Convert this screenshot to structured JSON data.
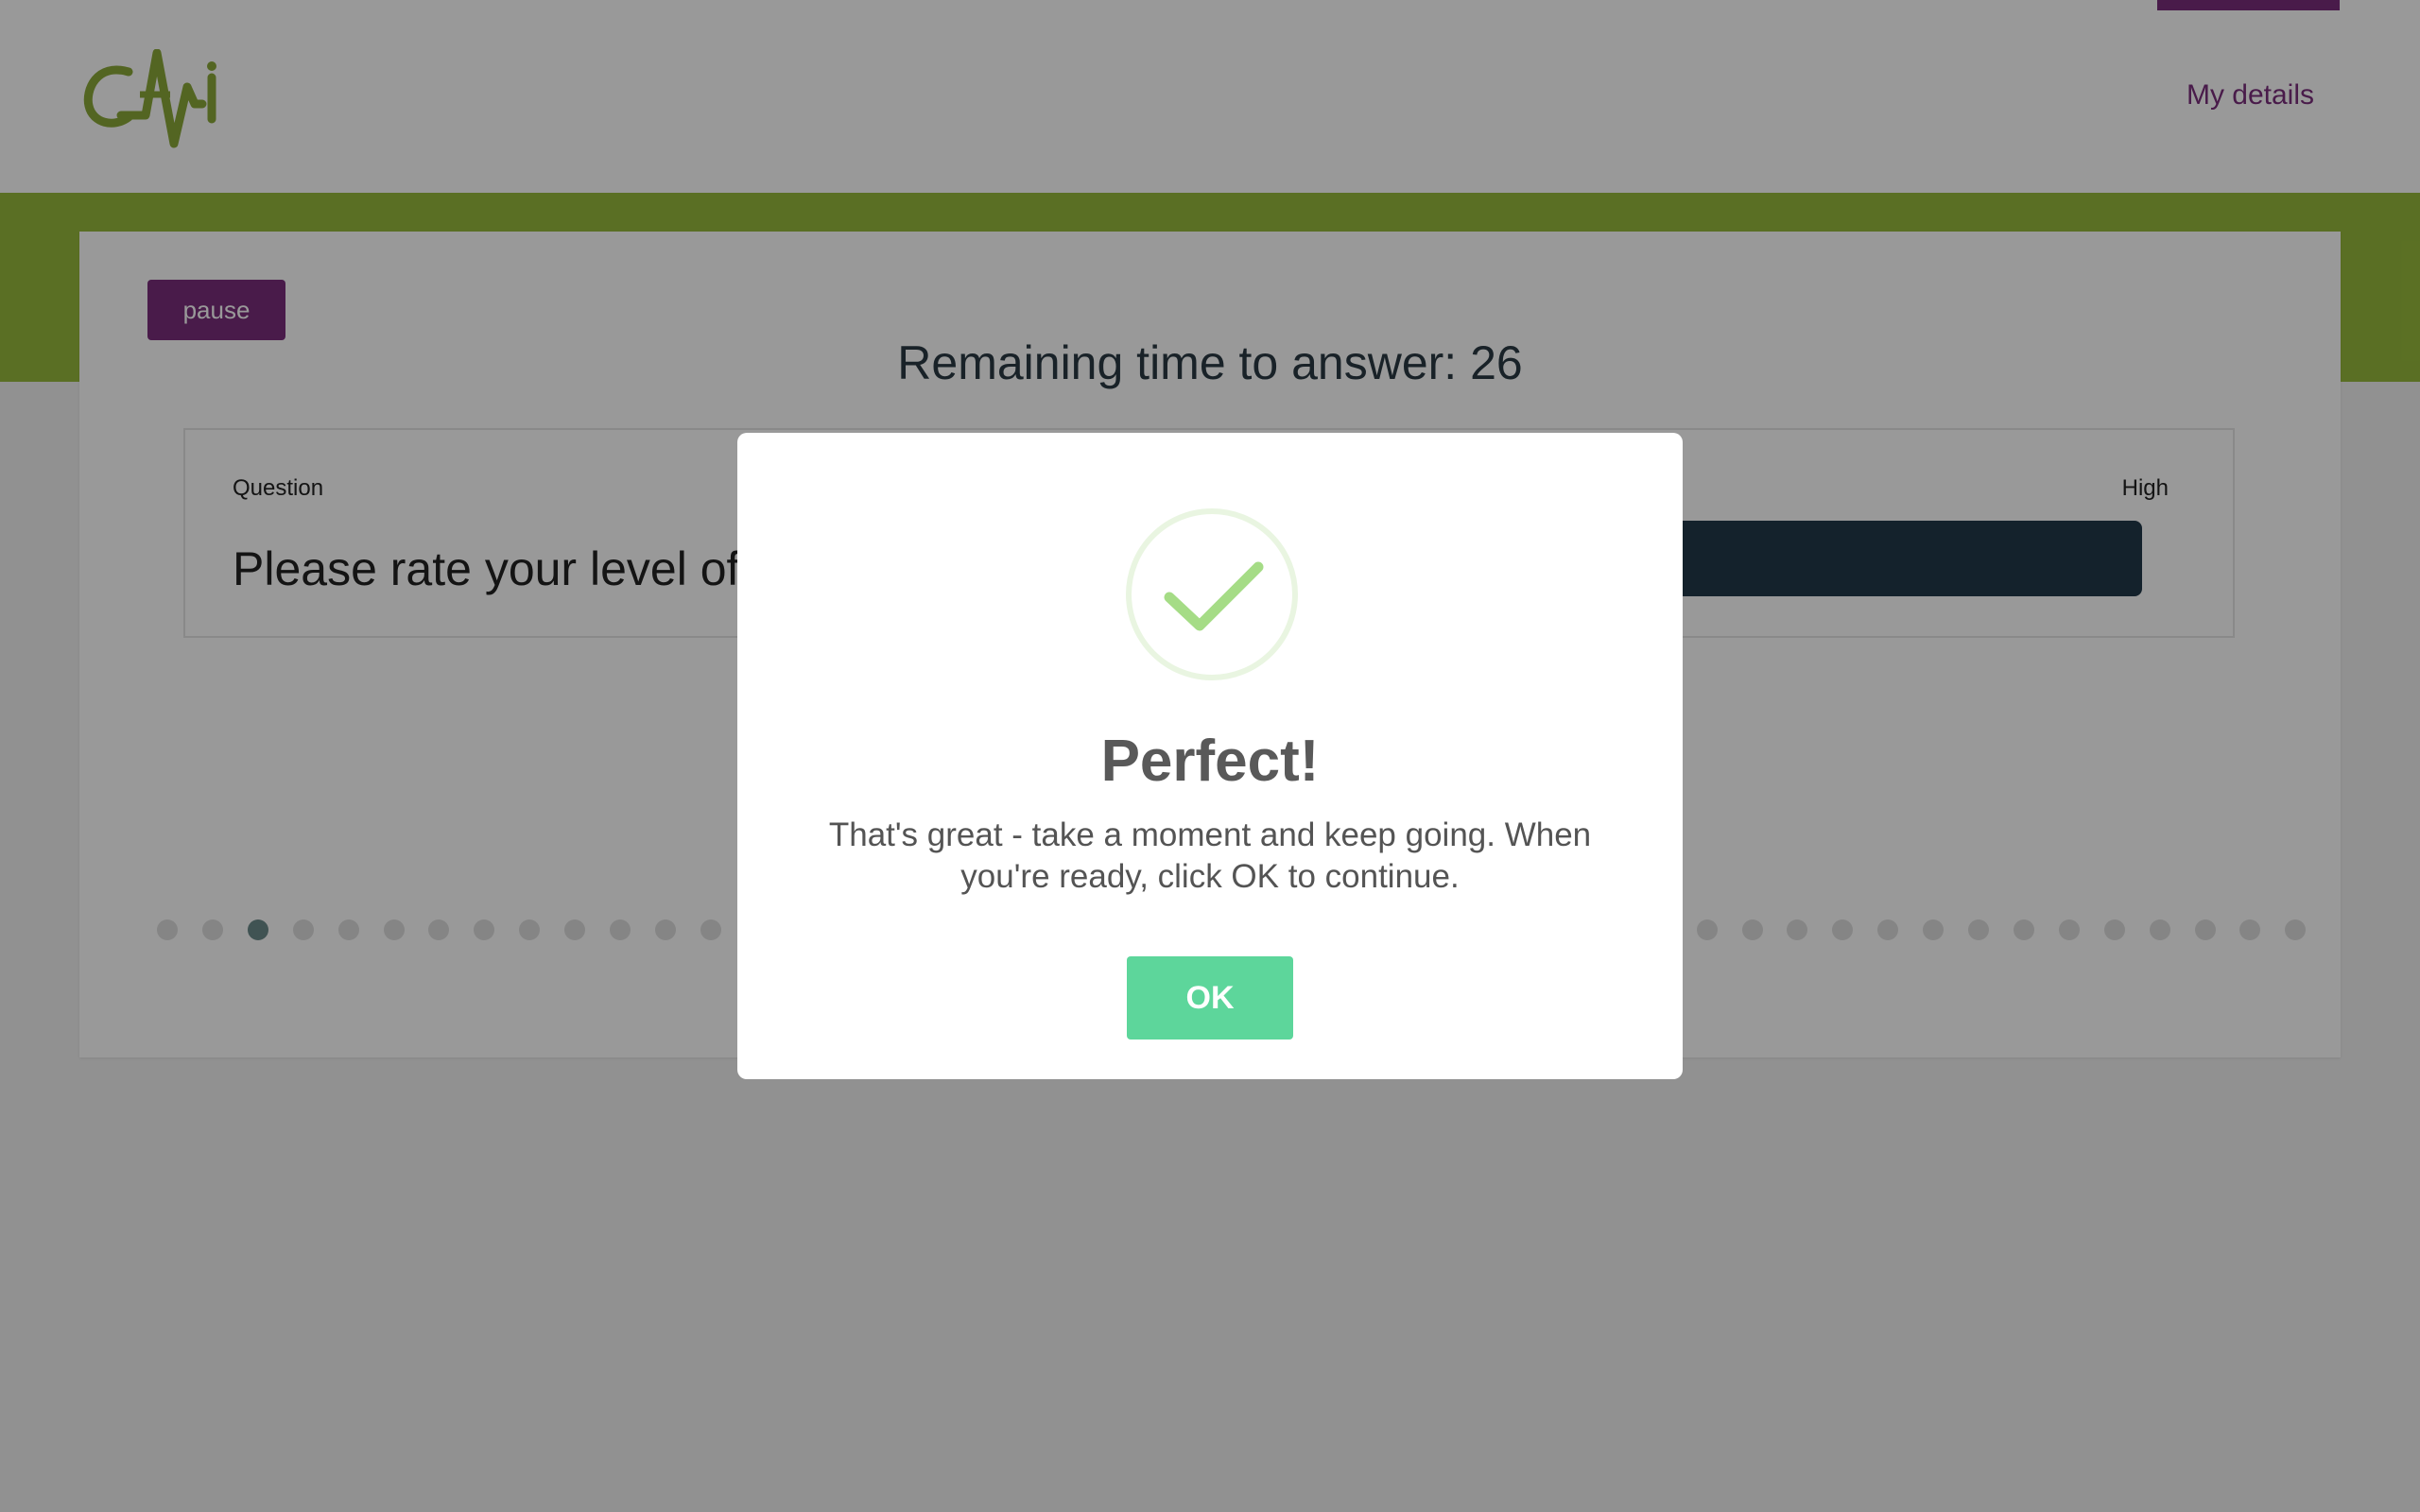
{
  "header": {
    "logo_text": "CAri",
    "my_details_label": "My details"
  },
  "main": {
    "pause_label": "pause",
    "timer_text": "Remaining time to answer: 26",
    "question_label": "Question",
    "high_label": "High",
    "question_text": "Please rate your level of",
    "progress": {
      "total": 48,
      "current": 3
    }
  },
  "modal": {
    "icon": "checkmark-icon",
    "title": "Perfect!",
    "message": "That's great - take a moment and keep going. When you're ready, click OK to continue.",
    "ok_label": "OK"
  },
  "colors": {
    "brand_purple": "#7a2e7c",
    "brand_green": "#97ba3c",
    "ok_green": "#5dd69b"
  }
}
